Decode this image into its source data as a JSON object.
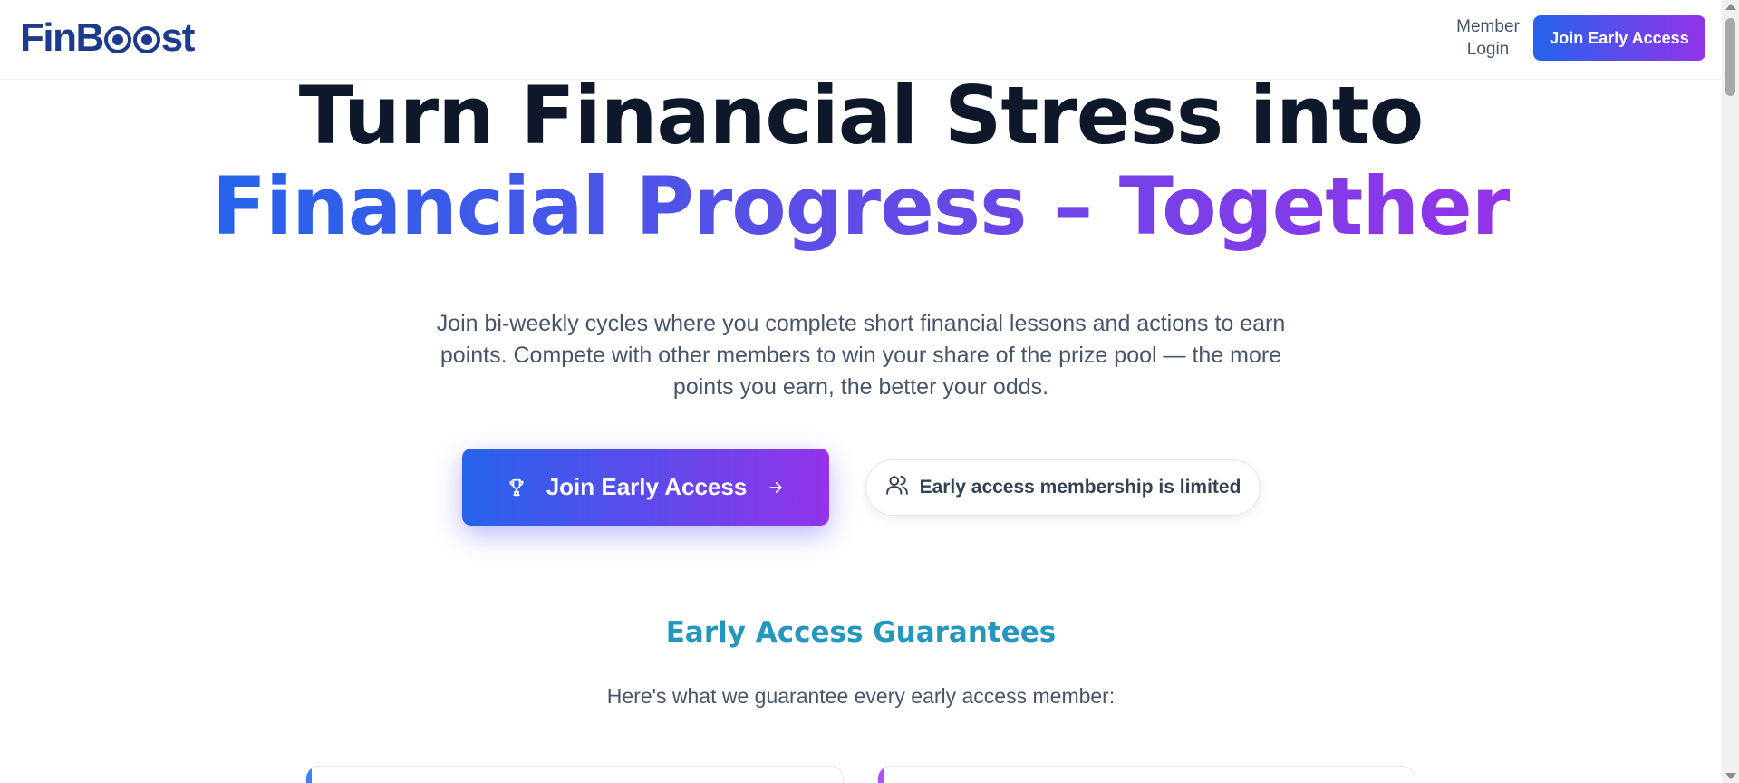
{
  "header": {
    "logo_text": "FinBoost",
    "member_login": "Member Login",
    "cta_label": "Join Early Access"
  },
  "hero": {
    "title_line1": "Turn Financial Stress into",
    "title_line2": "Financial Progress – Together",
    "subtitle": "Join bi-weekly cycles where you complete short financial lessons and actions to earn points. Compete with other members to win your share of the prize pool — the more points you earn, the better your odds.",
    "primary_cta": "Join Early Access",
    "limited_note": "Early access membership is limited"
  },
  "guarantees": {
    "title": "Early Access Guarantees",
    "subtitle": "Here's what we guarantee every early access member:"
  },
  "colors": {
    "brand_navy": "#1e3a8a",
    "gradient_start": "#2563eb",
    "gradient_end": "#9333ea",
    "section_title": "#2596be"
  },
  "icons": [
    "logo-icon",
    "trophy-icon",
    "arrow-right-icon",
    "users-icon"
  ]
}
